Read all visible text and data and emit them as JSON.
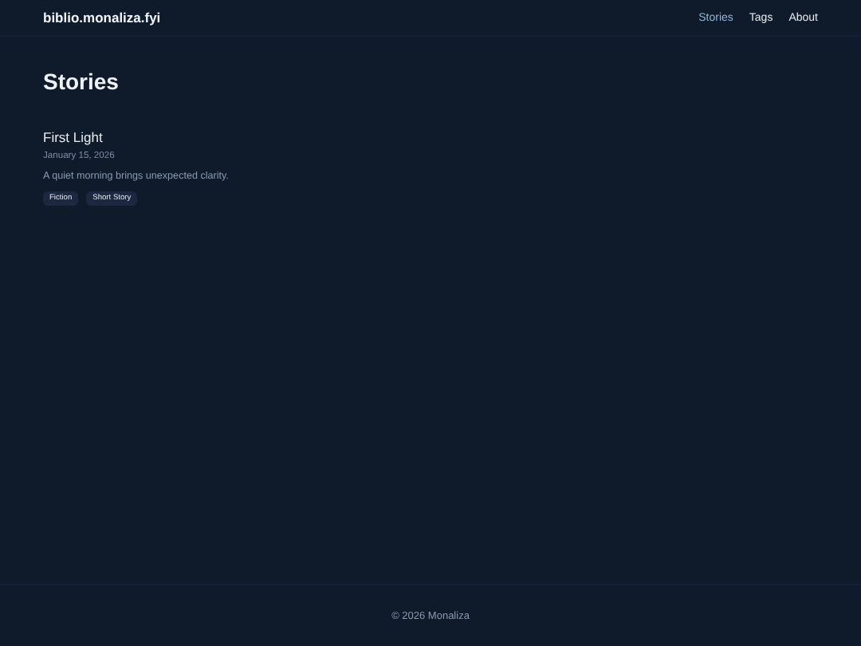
{
  "site_title": "biblio.monaliza.fyi",
  "nav": [
    {
      "label": "Stories",
      "selected": true
    },
    {
      "label": "Tags",
      "selected": false
    },
    {
      "label": "About",
      "selected": false
    }
  ],
  "heading": "Stories",
  "stories": [
    {
      "title": "First Light",
      "date": "January 15, 2026",
      "summary": "A quiet morning brings unexpected clarity.",
      "tags": [
        "Fiction",
        "Short Story"
      ]
    }
  ],
  "footer": "© 2026 Monaliza"
}
